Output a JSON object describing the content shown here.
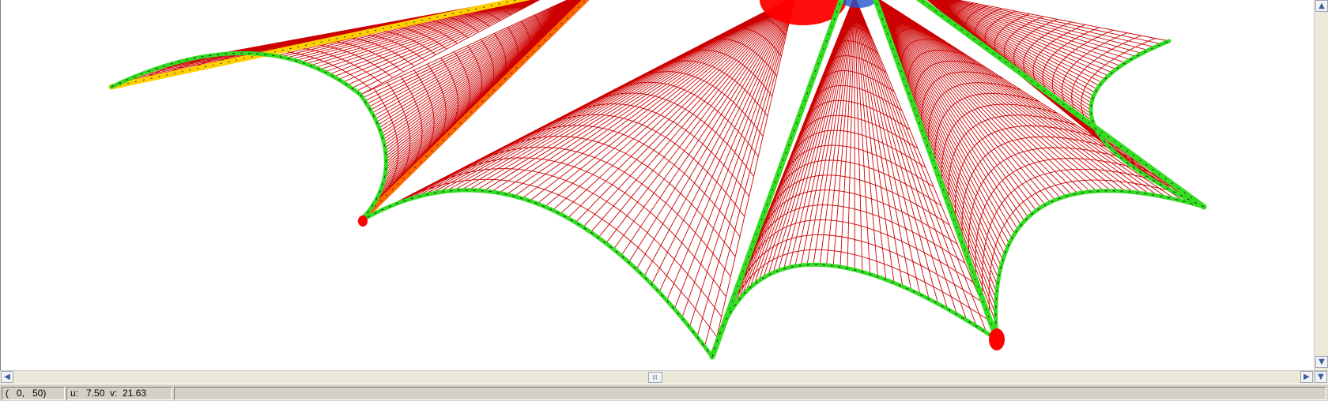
{
  "status_bar": {
    "grid_index": "(   0,   50)",
    "uv_readout": "u:   7.50  v:  21.63",
    "message": ""
  },
  "colors": {
    "mesh": "#cc0000",
    "boundary": "#33dd22",
    "boundary_warm": "#ffd000",
    "stress": "#ff6600",
    "hot": "#ff0000",
    "scroll_arrow": "#3a5fa8"
  },
  "icons": {
    "scroll_up": "triangle-up-icon",
    "scroll_down": "triangle-down-icon",
    "scroll_left": "triangle-left-icon",
    "scroll_right": "triangle-right-icon"
  }
}
